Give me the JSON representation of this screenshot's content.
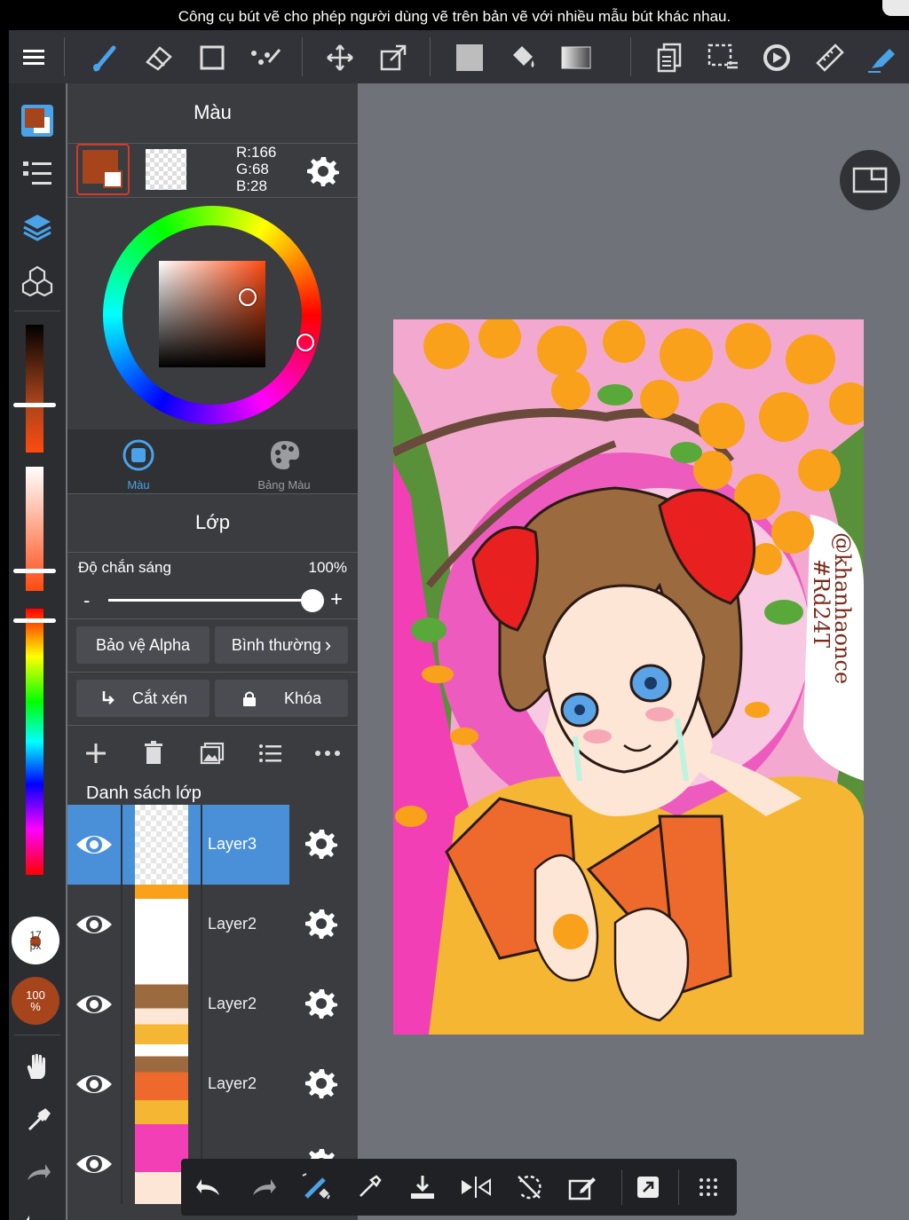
{
  "caption": "Công cụ bút vẽ cho phép người dùng vẽ trên bản vẽ với nhiều mẫu bút khác nhau.",
  "colors": {
    "current": "#a6441c",
    "selected_layer": "#4a90d9",
    "panel": "#3a3c40",
    "toolbar": "#313338",
    "workspace": "#6f7379"
  },
  "toolbar": {
    "items": [
      "menu-icon",
      "brush-icon",
      "eraser-icon",
      "rectangle-icon",
      "select-pen-icon",
      "move-icon",
      "transform-icon",
      "fill-color-icon",
      "bucket-icon",
      "gradient-icon",
      "layer-copy-icon",
      "selection-icon",
      "lasso-rotate-icon",
      "ruler-icon",
      "pen-active-icon"
    ]
  },
  "color_panel": {
    "title": "Màu",
    "r": "R:166",
    "g": "G:68",
    "b": "B:28",
    "tabs": {
      "color": "Màu",
      "palette": "Bảng Màu"
    }
  },
  "layer_panel": {
    "title": "Lớp",
    "opacity_label": "Độ chắn sáng",
    "opacity_value": "100%",
    "opacity": 1.0,
    "minus": "-",
    "plus": "+",
    "alpha_protect": "Bảo vệ Alpha",
    "blend_mode": "Bình thường",
    "clipping": "Cắt xén",
    "lock": "Khóa",
    "list_title": "Danh sách lớp",
    "layers": [
      {
        "name": "Layer3",
        "selected": true
      },
      {
        "name": "Layer2",
        "selected": false
      },
      {
        "name": "Layer2",
        "selected": false
      },
      {
        "name": "Layer2",
        "selected": false
      },
      {
        "name": "",
        "selected": false
      }
    ]
  },
  "leftbar": {
    "brush_size_value": "17",
    "brush_size_unit": "px",
    "brush_opacity_value": "100",
    "brush_opacity_unit": "%"
  },
  "canvas": {
    "signature_1": "@khanhaonce",
    "signature_2": "#Rd24T"
  }
}
